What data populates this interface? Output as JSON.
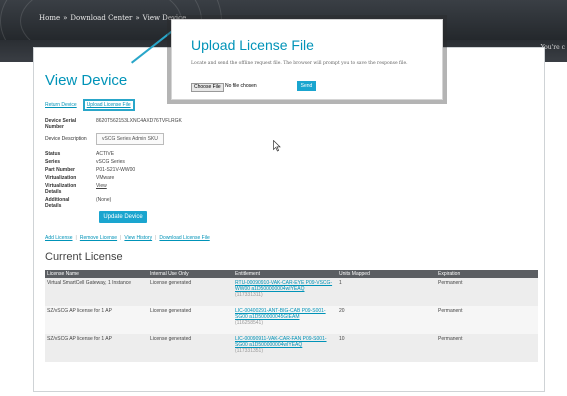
{
  "breadcrumb": [
    "Home",
    "Download Center",
    "View Device"
  ],
  "breadcrumb_separator": "»",
  "header_right_text": "You're c",
  "page_title": "View Device",
  "top_links": {
    "return_device": "Return Device",
    "upload_license_file": "Upload License File"
  },
  "details": [
    {
      "label": "Device Serial Number",
      "value": "8620T562153LXNC4AXD76TVFLRGK"
    },
    {
      "label": "Device Description",
      "value": "vSCG Series Admin SKU",
      "boxed": true
    },
    {
      "label": "Status",
      "value": "ACTIVE"
    },
    {
      "label": "Series",
      "value": "vSCG Series"
    },
    {
      "label": "Part Number",
      "value": "P01-S21V-WW00"
    },
    {
      "label": "Virtualization",
      "value": "VMware"
    },
    {
      "label": "Virtualization Details",
      "value": "View",
      "link": true
    },
    {
      "label": "Additional Details",
      "value": "(None)"
    }
  ],
  "update_button": "Update Device",
  "action_links": [
    "Add License",
    "Remove License",
    "View History",
    "Download License File"
  ],
  "section_title": "Current License",
  "table": {
    "headers": [
      "License Name",
      "Internal Use Only",
      "Entitlement",
      "Units Mapped",
      "Expiration"
    ],
    "rows": [
      {
        "name": "Virtual SmartCell Gateway, 1 Instance",
        "internal": "License generated",
        "entitlement": "RTU-00090910-VAK-CAR-EYE P09-VSCG-WW00 a1D500000004wIYEAQ",
        "entitlement_id": "(117331311)",
        "units": "1",
        "expiration": "Permanent"
      },
      {
        "name": "SZ/vSCG AP license for 1 AP",
        "internal": "License generated",
        "entitlement": "LIC-00400291-ANT-BIG-CAB P09-S001-SG00 a1D500000045GIEAM",
        "entitlement_id": "(116258541)",
        "units": "20",
        "expiration": "Permanent"
      },
      {
        "name": "SZ/vSCG AP license for 1 AP",
        "internal": "License generated",
        "entitlement": "LIC-00090911-VAK-CAR-FAN P09-S001-SG00 a1D500000004wIYEAQ",
        "entitlement_id": "(117331351)",
        "units": "10",
        "expiration": "Permanent"
      }
    ]
  },
  "popup": {
    "title": "Upload License File",
    "description": "Locate and send the offline request file. The browser will prompt you to save the response file.",
    "choose_file": "Choose File",
    "no_file": "No file chosen",
    "send": "Send"
  },
  "colors": {
    "accent": "#0093b8",
    "button": "#1aa5cf",
    "header_bg": "#2c3035",
    "table_header": "#5b5e62"
  }
}
